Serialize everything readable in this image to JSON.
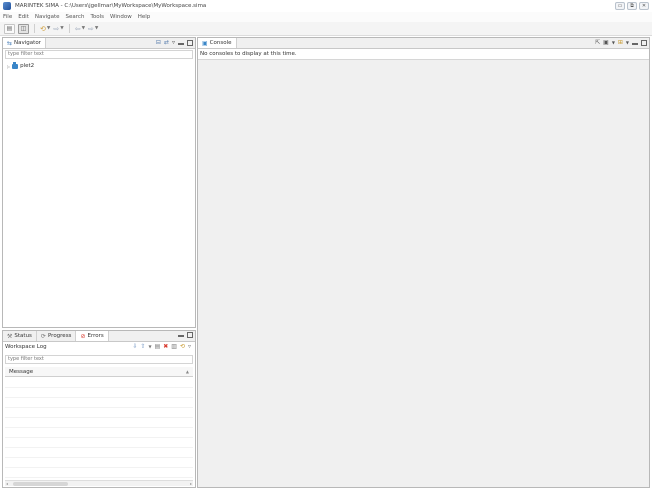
{
  "window": {
    "title": "MARINTEK SIMA - C:\\Users\\jgellmar\\MyWorkspace\\MyWorkspace.sima",
    "minimize": "▭",
    "restore": "⧉",
    "close": "✕"
  },
  "menu": [
    "File",
    "Edit",
    "Navigate",
    "Search",
    "Tools",
    "Window",
    "Help"
  ],
  "navigator": {
    "tab_label": "Navigator",
    "filter_placeholder": "type filter text",
    "items": [
      {
        "label": "plet2"
      }
    ]
  },
  "console": {
    "tab_label": "Console",
    "message": "No consoles to display at this time."
  },
  "bottom_panel": {
    "tabs": [
      "Status",
      "Progress",
      "Errors"
    ],
    "log_title": "Workspace Log",
    "filter_placeholder": "type filter text",
    "column_header": "Message"
  },
  "colors": {
    "accent": "#3a86c8",
    "error_red": "#d83a2e"
  }
}
